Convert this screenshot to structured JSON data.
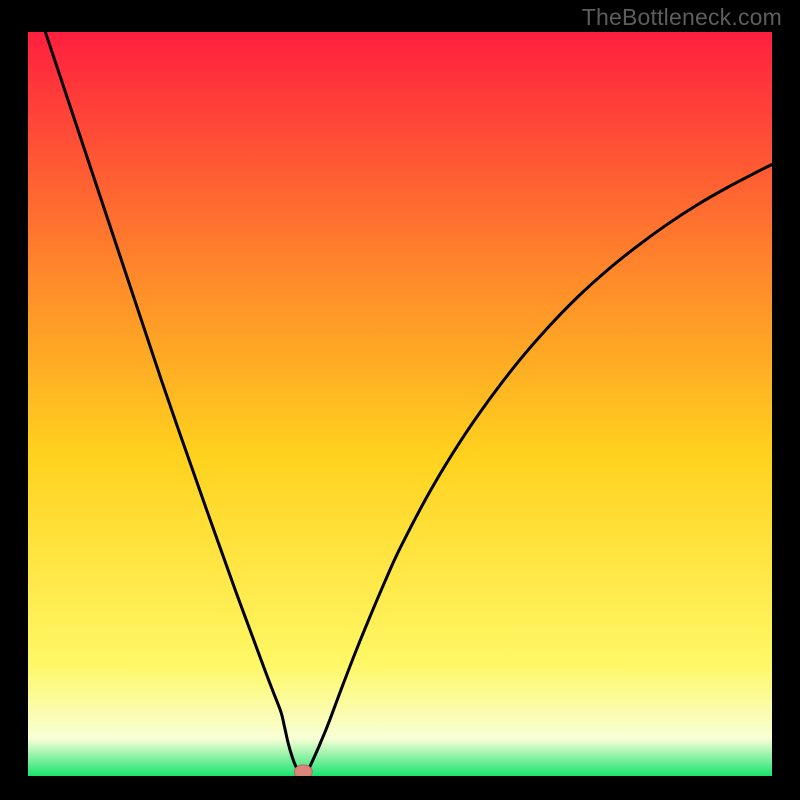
{
  "watermark": "TheBottleneck.com",
  "colors": {
    "gradient_top": "#ff1f3f",
    "gradient_mid_upper": "#ff8a2a",
    "gradient_mid": "#ffd21e",
    "gradient_mid_lower": "#fff866",
    "gradient_low": "#f8ffd6",
    "gradient_bottom": "#19e36e",
    "curve": "#000000",
    "marker_fill": "#d9857b",
    "marker_stroke": "#bb6a62"
  },
  "chart_data": {
    "type": "line",
    "title": "",
    "xlabel": "",
    "ylabel": "",
    "xlim": [
      0,
      100
    ],
    "ylim": [
      0,
      100
    ],
    "x": [
      0,
      2,
      4,
      6,
      8,
      10,
      12,
      14,
      16,
      18,
      20,
      22,
      24,
      26,
      28,
      30,
      32,
      33,
      34,
      34.5,
      35,
      35.5,
      36,
      36.6,
      37.4,
      38,
      40,
      42,
      44,
      46,
      48,
      50,
      54,
      58,
      62,
      66,
      70,
      74,
      78,
      82,
      86,
      90,
      94,
      98,
      100
    ],
    "values": [
      107,
      101,
      95,
      89,
      83,
      77,
      71,
      65,
      59,
      53,
      47.2,
      41.5,
      35.8,
      30.2,
      24.6,
      19.2,
      13.8,
      11.2,
      8.6,
      6.5,
      4.3,
      2.6,
      1.3,
      0.55,
      0.55,
      1.5,
      6.1,
      11.4,
      16.6,
      21.5,
      26.2,
      30.6,
      38.2,
      44.8,
      50.6,
      55.8,
      60.4,
      64.5,
      68.1,
      71.3,
      74.2,
      76.8,
      79.1,
      81.2,
      82.2
    ],
    "marker": {
      "x": 37,
      "y": 0.55
    },
    "gradient_stops": [
      {
        "offset": 0.0,
        "key": "gradient_top"
      },
      {
        "offset": 0.33,
        "key": "gradient_mid_upper"
      },
      {
        "offset": 0.57,
        "key": "gradient_mid"
      },
      {
        "offset": 0.85,
        "key": "gradient_mid_lower"
      },
      {
        "offset": 0.95,
        "key": "gradient_low"
      },
      {
        "offset": 1.0,
        "key": "gradient_bottom"
      }
    ]
  }
}
